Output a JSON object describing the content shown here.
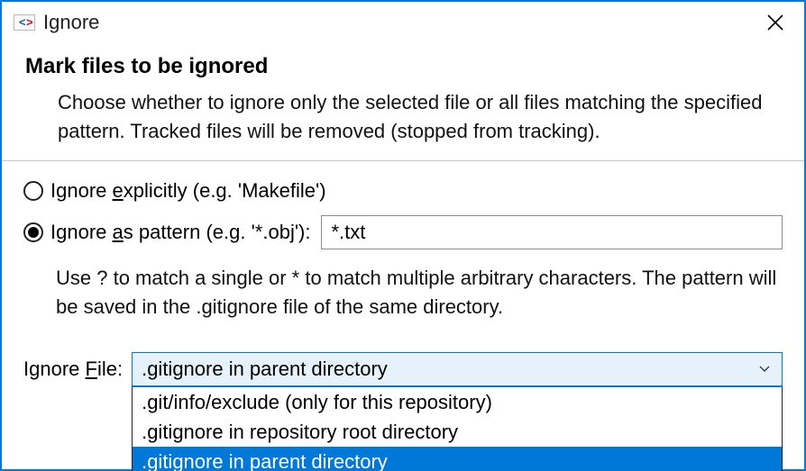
{
  "window": {
    "title": "Ignore"
  },
  "header": {
    "title": "Mark files to be ignored",
    "description": "Choose whether to ignore only the selected file or all files matching the specified pattern. Tracked files will be removed (stopped from tracking)."
  },
  "radios": {
    "explicit": {
      "pre": "Ignore ",
      "mn": "e",
      "post": "xplicitly (e.g. 'Makefile')",
      "selected": false
    },
    "pattern": {
      "pre": "Ignore ",
      "mn": "a",
      "post": "s pattern (e.g. '*.obj'):",
      "selected": true,
      "input_value": "*.txt",
      "hint": "Use ? to match a single or * to match multiple arbitrary characters. The pattern will be saved in the .gitignore file of the same directory."
    }
  },
  "ignore_file": {
    "label_pre": "Ignore ",
    "label_mn": "F",
    "label_post": "ile:",
    "selected_value": ".gitignore in parent directory",
    "options": [
      {
        "text": ".git/info/exclude (only for this repository)",
        "selected": false
      },
      {
        "text": ".gitignore in repository root directory",
        "selected": false
      },
      {
        "text": ".gitignore in parent directory",
        "selected": true
      }
    ]
  },
  "colors": {
    "accent": "#0078d7",
    "combo_bg": "#e6f2fb"
  }
}
